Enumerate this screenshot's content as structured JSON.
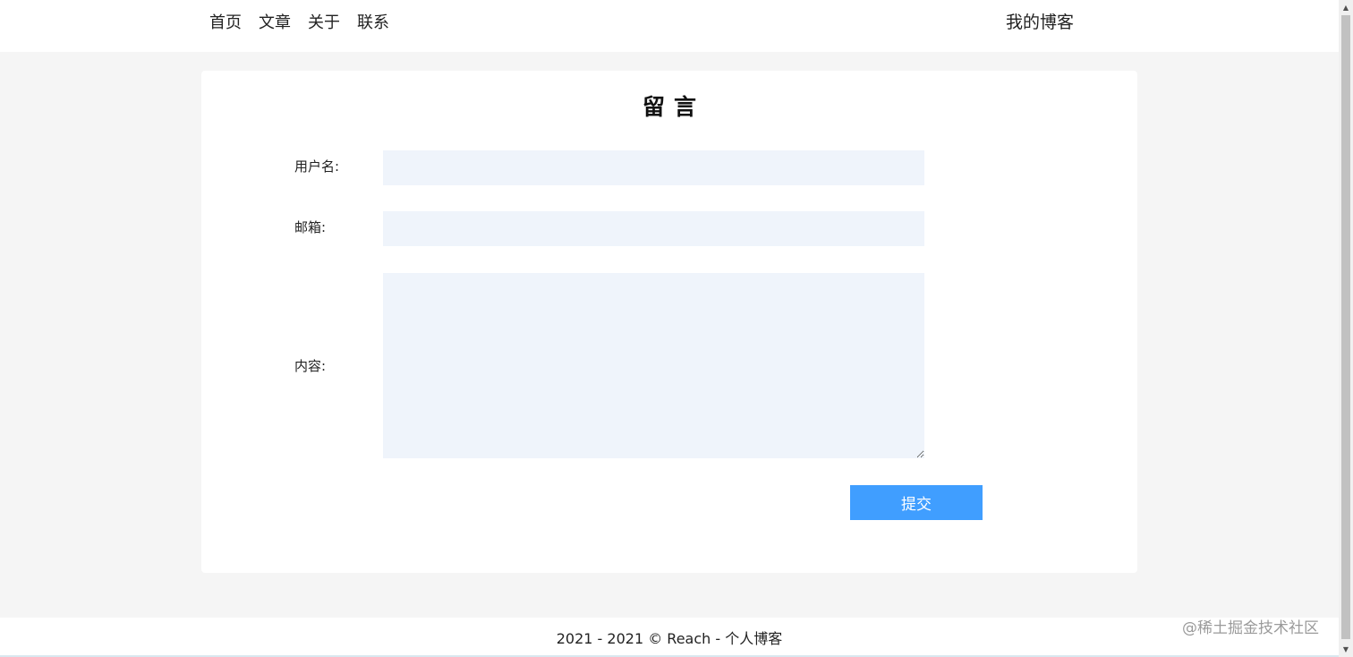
{
  "header": {
    "nav": [
      {
        "label": "首页"
      },
      {
        "label": "文章"
      },
      {
        "label": "关于"
      },
      {
        "label": "联系"
      }
    ],
    "brand": "我的博客"
  },
  "form": {
    "title": "留言",
    "username_label": "用户名:",
    "username_value": "",
    "email_label": "邮箱:",
    "email_value": "",
    "content_label": "内容:",
    "content_value": "",
    "submit_label": "提交"
  },
  "footer": {
    "text": "2021 - 2021 © Reach - 个人博客"
  },
  "watermark": "@稀土掘金技术社区",
  "colors": {
    "accent": "#409eff",
    "input_bg": "#eff4fb",
    "page_bg": "#f5f5f5"
  }
}
